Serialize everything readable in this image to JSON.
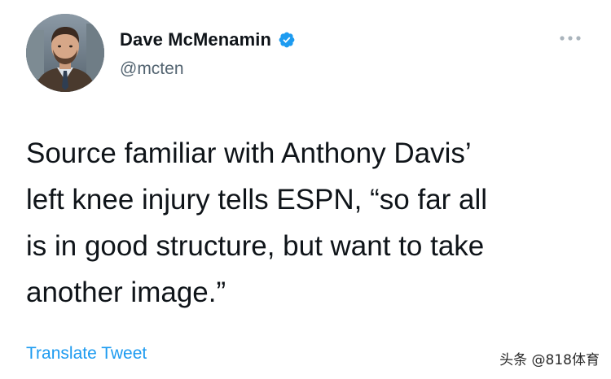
{
  "author": {
    "display_name": "Dave McMenamin",
    "handle": "@mcten",
    "verified": true,
    "avatar_icon": "person-avatar"
  },
  "tweet": {
    "text": "Source familiar with Anthony Davis’\nleft knee injury tells ESPN, “so far all\nis in good structure, but want to take\nanother image.”"
  },
  "actions": {
    "more_icon": "more-horizontal-icon",
    "translate_label": "Translate Tweet"
  },
  "watermark": {
    "text": "头条 @818体育"
  },
  "colors": {
    "text_primary": "#0f1419",
    "text_secondary": "#536471",
    "link": "#1d9bf0",
    "verified_badge": "#1d9bf0"
  }
}
